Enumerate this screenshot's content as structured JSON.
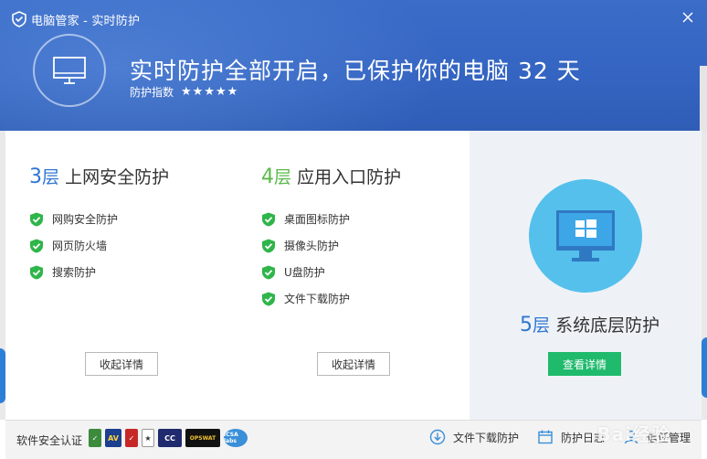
{
  "window": {
    "title": "电脑管家 - 实时防护"
  },
  "header": {
    "headline": "实时防护全部开启，已保护你的电脑 32 天",
    "index_label": "防护指数",
    "stars": "★★★★★"
  },
  "layers": [
    {
      "num": "3",
      "unit": "层",
      "title": "上网安全防护",
      "items": [
        "网购安全防护",
        "网页防火墙",
        "搜索防护"
      ],
      "button": "收起详情"
    },
    {
      "num": "4",
      "unit": "层",
      "title": "应用入口防护",
      "items": [
        "桌面图标防护",
        "摄像头防护",
        "U盘防护",
        "文件下载防护"
      ],
      "button": "收起详情"
    },
    {
      "num": "5",
      "unit": "层",
      "title": "系统底层防护",
      "button": "查看详情"
    }
  ],
  "footer": {
    "cert_label": "软件安全认证",
    "badges": [
      "AV",
      "✓",
      "CC",
      "OPSWAT",
      "ICSA labs"
    ],
    "links": [
      "文件下载防护",
      "防护日志",
      "信任管理"
    ]
  },
  "watermark": "Bai经验",
  "colors": {
    "header_blue": "#3565c2",
    "accent_blue": "#2f76d2",
    "accent_green": "#5ab94a",
    "button_green": "#1fba6c",
    "check_green": "#2fb54a",
    "circle_blue": "#55c0ec"
  },
  "icons": {
    "logo": "shield-icon",
    "close": "close-icon",
    "monitor": "monitor-icon",
    "check": "check-shield-icon",
    "windows": "windows-monitor-icon",
    "download": "download-icon",
    "log": "calendar-icon",
    "trust": "user-icon"
  }
}
